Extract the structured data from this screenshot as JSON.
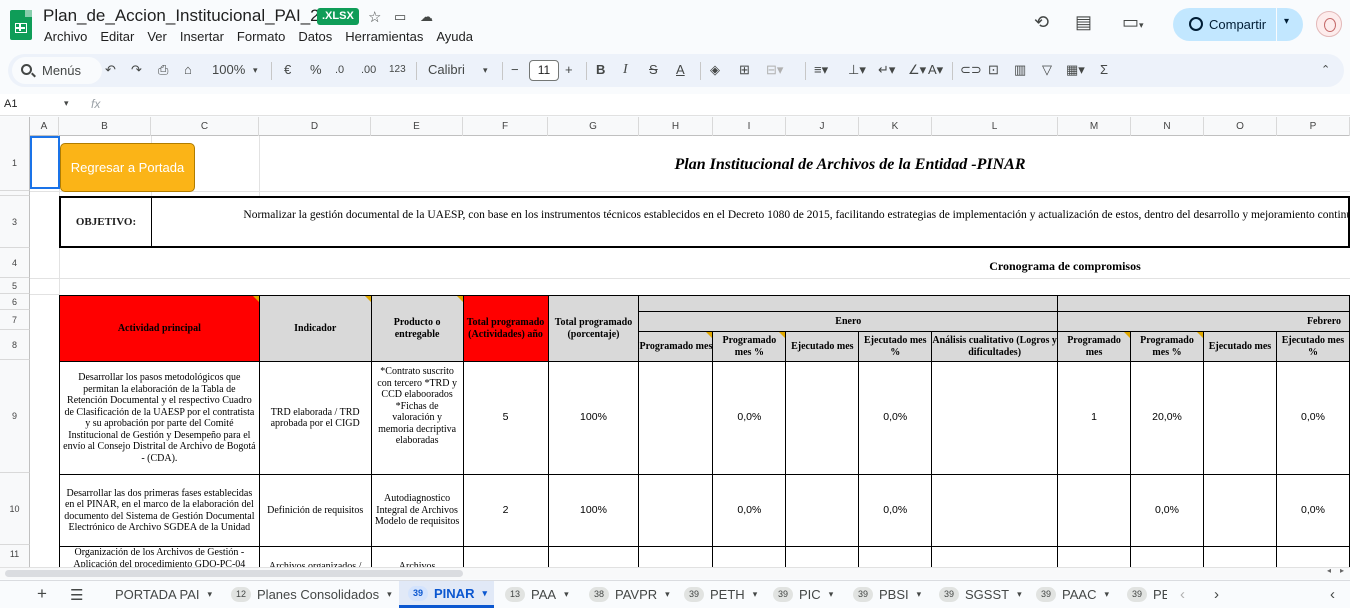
{
  "app": {
    "doc_title": "Plan_de_Accion_Institucional_PAI_2023",
    "file_badge": ".XLSX",
    "menu": [
      "Archivo",
      "Editar",
      "Ver",
      "Insertar",
      "Formato",
      "Datos",
      "Herramientas",
      "Ayuda"
    ],
    "share_label": "Compartir"
  },
  "toolbar": {
    "menus_label": "Menús",
    "zoom": "100%",
    "currency": "€",
    "percent": "%",
    "dec_decrease": ".0",
    "dec_increase": ".00",
    "number_format": "123",
    "font_name": "Calibri",
    "font_size": "11"
  },
  "formula_bar": {
    "cell_ref": "A1",
    "fx_label": "fx"
  },
  "grid": {
    "columns": [
      "A",
      "B",
      "C",
      "D",
      "E",
      "F",
      "G",
      "H",
      "I",
      "J",
      "K",
      "L",
      "M",
      "N",
      "O",
      "P"
    ],
    "rows": [
      "1",
      "2",
      "3",
      "4",
      "5",
      "6",
      "7",
      "8",
      "9",
      "10",
      "11"
    ]
  },
  "sheet": {
    "back_button": "Regresar a Portada",
    "title": "Plan Institucional de Archivos de la Entidad -PINAR",
    "objetivo_label": "OBJETIVO:",
    "objetivo_text": "Normalizar la gestión documental de la UAESP, con base en los instrumentos técnicos establecidos en el Decreto 1080 de 2015, facilitando estrategias de implementación y actualización de estos, dentro del desarrollo y mejoramiento continuo del SIGA",
    "cronograma_title": "Cronograma de compromisos",
    "headers": {
      "actividad": "Actividad principal",
      "indicador": "Indicador",
      "producto": "Producto o entregable",
      "total_actividades": "Total programado (Actividades) año",
      "total_porcentaje": "Total programado (porcentaje)",
      "month_1": "Enero",
      "month_2": "Febrero",
      "programado_mes": "Programado mes",
      "programado_mes_pct": "Programado mes %",
      "ejecutado_mes": "Ejecutado mes",
      "ejecutado_mes_pct": "Ejecutado mes %",
      "analisis": "Análisis cualitativo (Logros y dificultades)"
    },
    "rows": [
      {
        "actividad": "Desarrollar los pasos metodológicos que permitan la elaboración  de la Tabla de Retención Documental y el respectivo Cuadro de Clasificación de la UAESP por el contratista y su aprobación por parte del Comité Institucional de Gestión y Desempeño  para el envío al Consejo Distrital de Archivo de Bogotá - (CDA).",
        "indicador": "TRD elaborada / TRD aprobada por el CIGD",
        "producto": "*Contrato suscrito con tercero *TRD y  CCD elaboorados *Fichas de valoración y memoria decriptiva elaboradas",
        "total_actividades": "5",
        "total_porcentaje": "100%",
        "ene_prog": "",
        "ene_prog_pct": "0,0%",
        "ene_ejec": "",
        "ene_ejec_pct": "0,0%",
        "ene_analisis": "",
        "feb_prog": "1",
        "feb_prog_pct": "20,0%",
        "feb_ejec": "",
        "feb_ejec_pct": "0,0%"
      },
      {
        "actividad": "Desarrollar las dos primeras fases establecidas en el PINAR, en el marco de la elaboración del documento del Sistema de Gestión Documental Electrónico de Archivo SGDEA de la Unidad",
        "indicador": "Definición de requisitos",
        "producto": "Autodiagnostico Integral de Archivos Modelo de requisitos",
        "total_actividades": "2",
        "total_porcentaje": "100%",
        "ene_prog": "",
        "ene_prog_pct": "0,0%",
        "ene_ejec": "",
        "ene_ejec_pct": "0,0%",
        "ene_analisis": "",
        "feb_prog": "",
        "feb_prog_pct": "0,0%",
        "feb_ejec": "",
        "feb_ejec_pct": "0,0%"
      },
      {
        "actividad": "Organización de los Archivos de Gestión - Aplicación del procedimiento GDO-PC-04",
        "indicador": "Archivos organizados / ",
        "producto": "Archivos",
        "total_actividades": "",
        "total_porcentaje": "",
        "ene_prog": "",
        "ene_prog_pct": "",
        "ene_ejec": "",
        "ene_ejec_pct": "",
        "ene_analisis": "",
        "feb_prog": "",
        "feb_prog_pct": "",
        "feb_ejec": "",
        "feb_ejec_pct": ""
      }
    ]
  },
  "tabs": [
    {
      "badge": "",
      "label": "PORTADA PAI"
    },
    {
      "badge": "12",
      "label": "Planes Consolidados"
    },
    {
      "badge": "39",
      "label": "PINAR"
    },
    {
      "badge": "13",
      "label": "PAA"
    },
    {
      "badge": "38",
      "label": "PAVPR"
    },
    {
      "badge": "39",
      "label": "PETH"
    },
    {
      "badge": "39",
      "label": "PIC"
    },
    {
      "badge": "39",
      "label": "PBSI"
    },
    {
      "badge": "39",
      "label": "SGSST"
    },
    {
      "badge": "39",
      "label": "PAAC"
    },
    {
      "badge": "39",
      "label": "PE"
    }
  ]
}
